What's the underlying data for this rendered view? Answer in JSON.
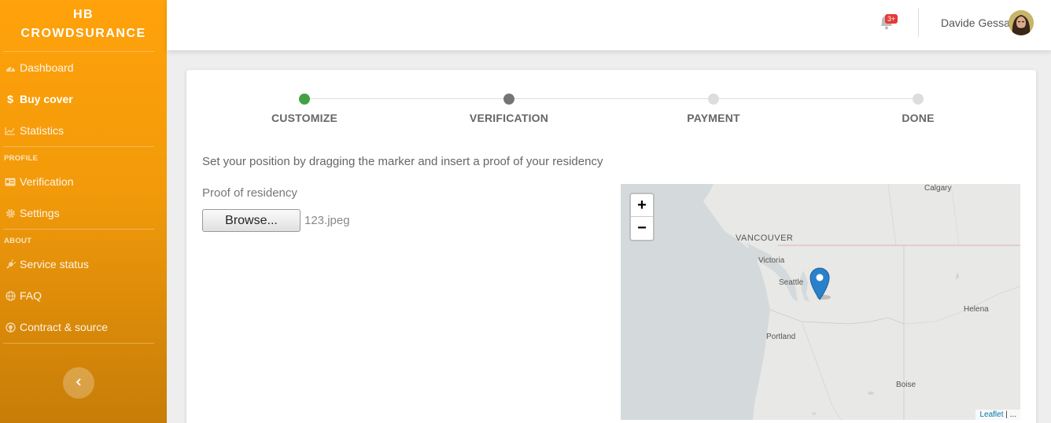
{
  "brand": {
    "line1": "HB",
    "line2": "CROWDSURANCE"
  },
  "sidebar": {
    "items": [
      {
        "label": "Dashboard",
        "icon": "dashboard-icon"
      },
      {
        "label": "Buy cover",
        "icon": "dollar-icon",
        "active": true
      },
      {
        "label": "Statistics",
        "icon": "line-chart-icon"
      }
    ],
    "profile_section": "PROFILE",
    "profile_items": [
      {
        "label": "Verification",
        "icon": "id-card-icon"
      },
      {
        "label": "Settings",
        "icon": "gear-icon"
      }
    ],
    "about_section": "ABOUT",
    "about_items": [
      {
        "label": "Service status",
        "icon": "plug-icon"
      },
      {
        "label": "FAQ",
        "icon": "globe-icon"
      },
      {
        "label": "Contract & source",
        "icon": "github-icon"
      }
    ],
    "collapse_icon": "chevron-left-icon"
  },
  "topbar": {
    "notification_badge": "3+",
    "user_name": "Davide Gessa"
  },
  "steps": [
    {
      "label": "CUSTOMIZE",
      "state": "done",
      "color": "#43a047"
    },
    {
      "label": "VERIFICATION",
      "state": "current",
      "color": "#757575"
    },
    {
      "label": "PAYMENT",
      "state": "pending",
      "color": "#dddddd"
    },
    {
      "label": "DONE",
      "state": "pending",
      "color": "#dddddd"
    }
  ],
  "form": {
    "instructions": "Set your position by dragging the marker and insert a proof of your residency",
    "proof_label": "Proof of residency",
    "browse_label": "Browse...",
    "file_name": "123.jpeg"
  },
  "map": {
    "zoom_in": "+",
    "zoom_out": "−",
    "cities": [
      "Calgary",
      "VANCOUVER",
      "Victoria",
      "Seattle",
      "Portland",
      "Helena",
      "Boise"
    ],
    "attribution_link": "Leaflet",
    "attribution_rest": " | ..."
  },
  "colors": {
    "accent": "#ffa20b",
    "marker": "#2a81cb",
    "step_done": "#43a047"
  }
}
